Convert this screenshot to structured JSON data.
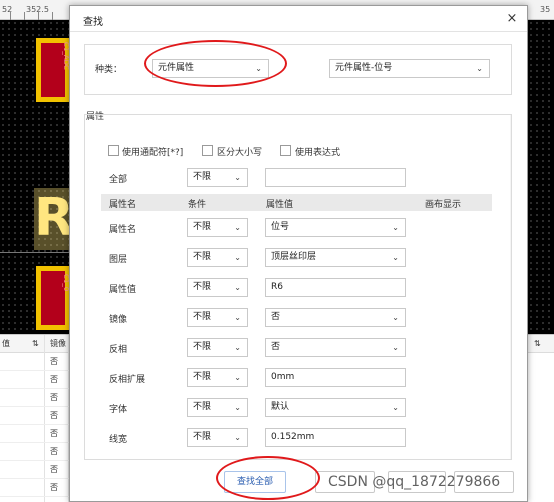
{
  "background": {
    "ruler_labels": [
      "52",
      "352.5",
      "35"
    ],
    "pad_labels": [
      "C1_ADC",
      "C1_0"
    ],
    "silk_letter": "R",
    "table": {
      "col_labels": [
        "值",
        "镜像"
      ],
      "sort_symbols": [
        "⇅",
        "⇅",
        "⇅"
      ],
      "mirror_values": [
        "否",
        "否",
        "否",
        "否",
        "否",
        "否",
        "否",
        "否"
      ]
    }
  },
  "dialog": {
    "title": "查找",
    "close_symbol": "×",
    "type_label": "种类：",
    "type_select": "元件属性",
    "subtype_select": "元件属性-位号",
    "props_legend": "属性",
    "options": [
      {
        "label": "使用通配符[*?]"
      },
      {
        "label": "区分大小写"
      },
      {
        "label": "使用表达式"
      }
    ],
    "all_label": "全部",
    "all_condition": "不限",
    "all_value": "",
    "headers": {
      "name": "属性名",
      "condition": "条件",
      "value": "属性值",
      "canvas": "画布显示"
    },
    "rows": [
      {
        "name": "属性名",
        "condition": "不限",
        "value": "位号"
      },
      {
        "name": "图层",
        "condition": "不限",
        "value": "顶层丝印层"
      },
      {
        "name": "属性值",
        "condition": "不限",
        "value": "R6"
      },
      {
        "name": "镜像",
        "condition": "不限",
        "value": "否"
      },
      {
        "name": "反相",
        "condition": "不限",
        "value": "否"
      },
      {
        "name": "反相扩展",
        "condition": "不限",
        "value": "0mm"
      },
      {
        "name": "字体",
        "condition": "不限",
        "value": "默认"
      },
      {
        "name": "线宽",
        "condition": "不限",
        "value": "0.152mm"
      }
    ],
    "buttons": {
      "find_all": "查找全部"
    },
    "dropdown_chevron": "⌄",
    "watermark": "CSDN @qq_1872279866"
  }
}
